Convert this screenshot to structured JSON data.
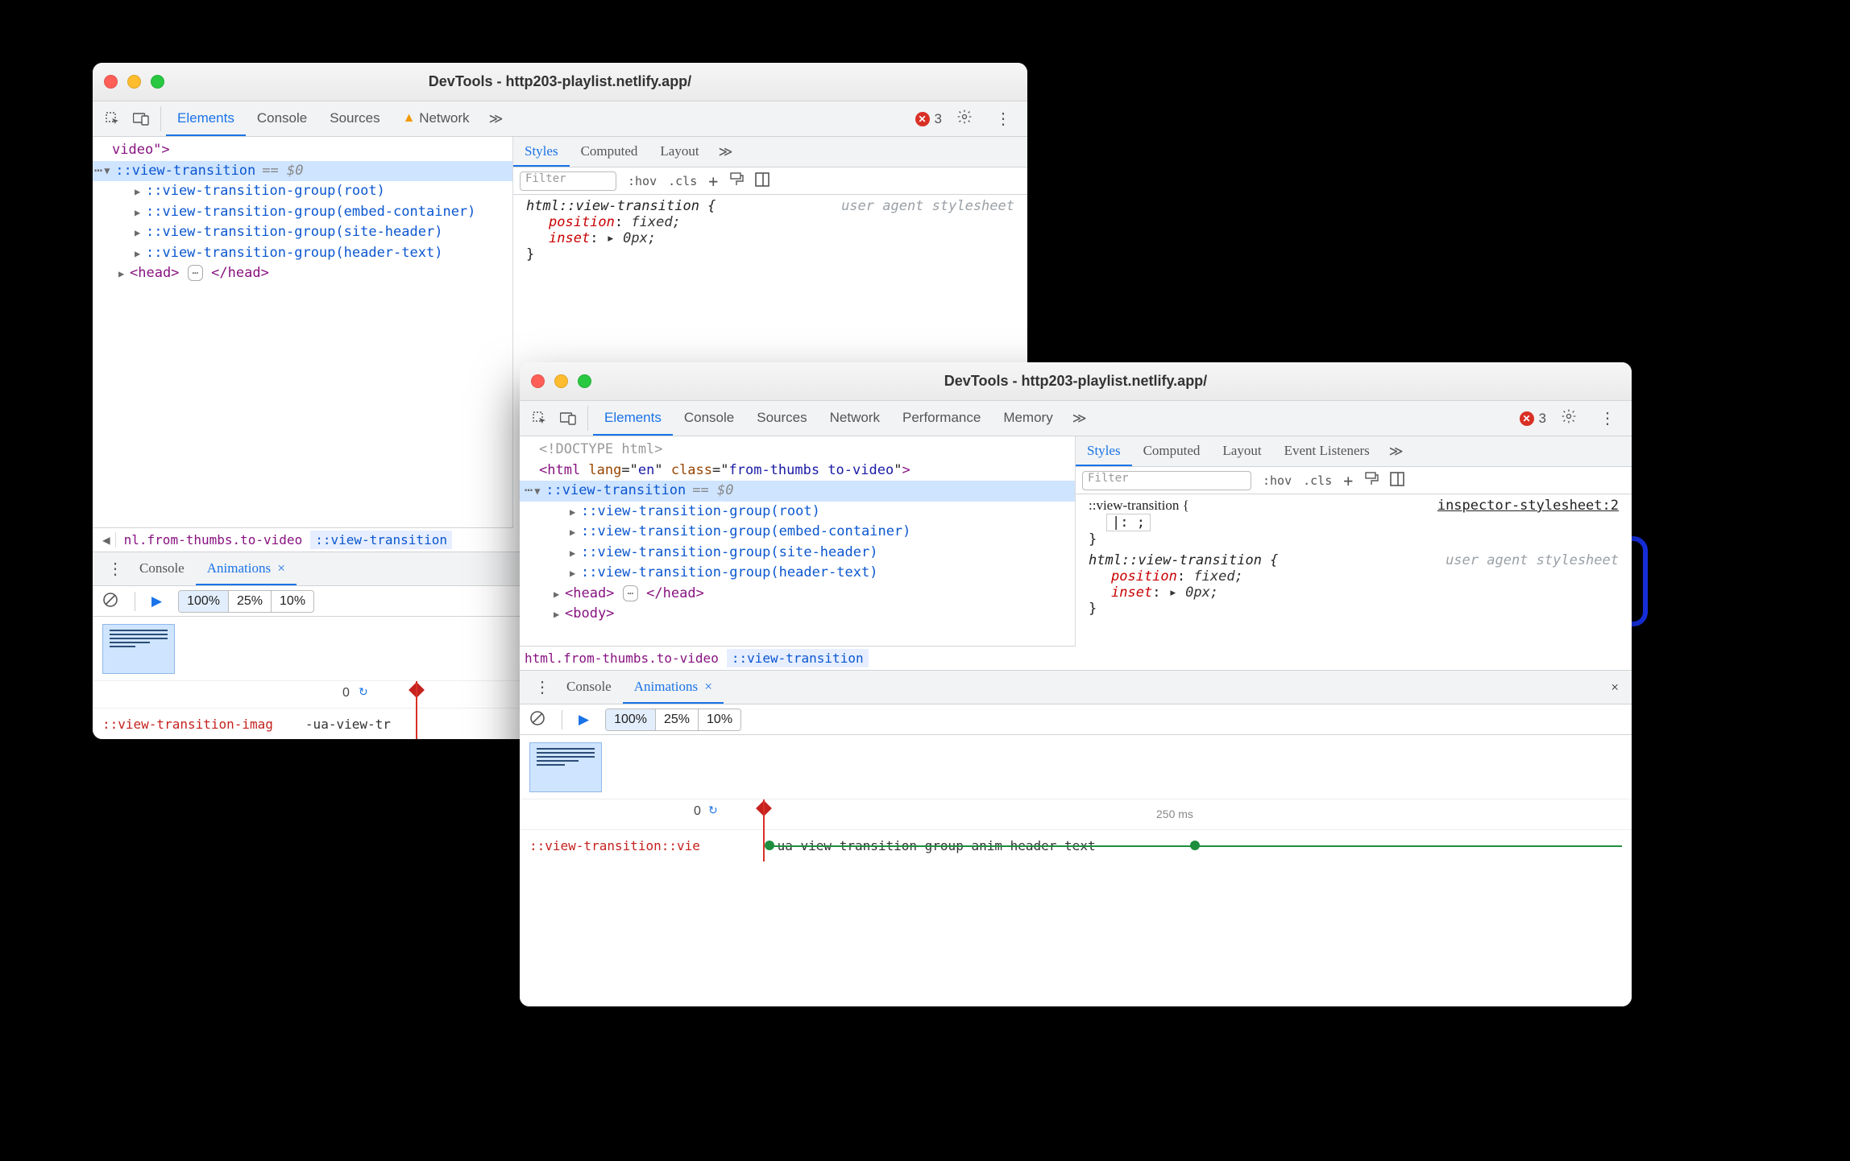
{
  "win1": {
    "title": "DevTools - http203-playlist.netlify.app/",
    "tabs": [
      "Elements",
      "Console",
      "Sources",
      "Network"
    ],
    "activeTab": "Elements",
    "networkWarn": true,
    "errCount": "3",
    "dom": {
      "lineTop": "video\">",
      "selected": "::view-transition",
      "eqzero": "== $0",
      "groups": [
        "::view-transition-group(root)",
        "::view-transition-group(embed-container)",
        "::view-transition-group(site-header)",
        "::view-transition-group(header-text)"
      ],
      "headOpen": "<head>",
      "headClose": "</head>"
    },
    "breadcrumb": {
      "item1": "nl.from-thumbs.to-video",
      "item2": "::view-transition"
    },
    "styles": {
      "tabs": [
        "Styles",
        "Computed",
        "Layout"
      ],
      "activeTab": "Styles",
      "filter": "Filter",
      "hov": ":hov",
      "cls": ".cls",
      "rule1": {
        "selector": "html::view-transition {",
        "ua": "user agent stylesheet",
        "props": [
          {
            "name": "position",
            "val": "fixed;"
          },
          {
            "name": "inset",
            "val": "▸ 0px;"
          }
        ],
        "close": "}"
      }
    },
    "drawer": {
      "tabs": [
        "Console",
        "Animations"
      ],
      "activeTab": "Animations",
      "speeds": [
        "100%",
        "25%",
        "10%"
      ],
      "activeSpeed": "100%",
      "zero": "0",
      "animLeft": "::view-transition-imag",
      "animName": "-ua-view-tr"
    }
  },
  "win2": {
    "title": "DevTools - http203-playlist.netlify.app/",
    "tabs": [
      "Elements",
      "Console",
      "Sources",
      "Network",
      "Performance",
      "Memory"
    ],
    "activeTab": "Elements",
    "errCount": "3",
    "dom": {
      "doctype": "<!DOCTYPE html>",
      "htmlOpen": "<html lang=\"en\" class=\"from-thumbs to-video\">",
      "selected": "::view-transition",
      "eqzero": "== $0",
      "groups": [
        "::view-transition-group(root)",
        "::view-transition-group(embed-container)",
        "::view-transition-group(site-header)",
        "::view-transition-group(header-text)"
      ],
      "headOpen": "<head>",
      "headEll": "⋯",
      "headClose": "</head>",
      "bodyOpen": "<body>"
    },
    "breadcrumb": {
      "item1": "html.from-thumbs.to-video",
      "item2": "::view-transition"
    },
    "styles": {
      "tabs": [
        "Styles",
        "Computed",
        "Layout",
        "Event Listeners"
      ],
      "activeTab": "Styles",
      "filter": "Filter",
      "hov": ":hov",
      "cls": ".cls",
      "ruleEdit": {
        "selector": "::view-transition {",
        "src": "inspector-stylesheet:2",
        "cursor": "|:  ;",
        "close": "}"
      },
      "rule1": {
        "selector": "html::view-transition {",
        "ua": "user agent stylesheet",
        "props": [
          {
            "name": "position",
            "val": "fixed;"
          },
          {
            "name": "inset",
            "val": "▸ 0px;"
          }
        ],
        "close": "}"
      }
    },
    "drawer": {
      "tabs": [
        "Console",
        "Animations"
      ],
      "activeTab": "Animations",
      "speeds": [
        "100%",
        "25%",
        "10%"
      ],
      "activeSpeed": "100%",
      "zero": "0",
      "tick": "250 ms",
      "animLeft": "::view-transition::vie",
      "animName": "-ua-view-transition-group-anim-header-text"
    }
  }
}
